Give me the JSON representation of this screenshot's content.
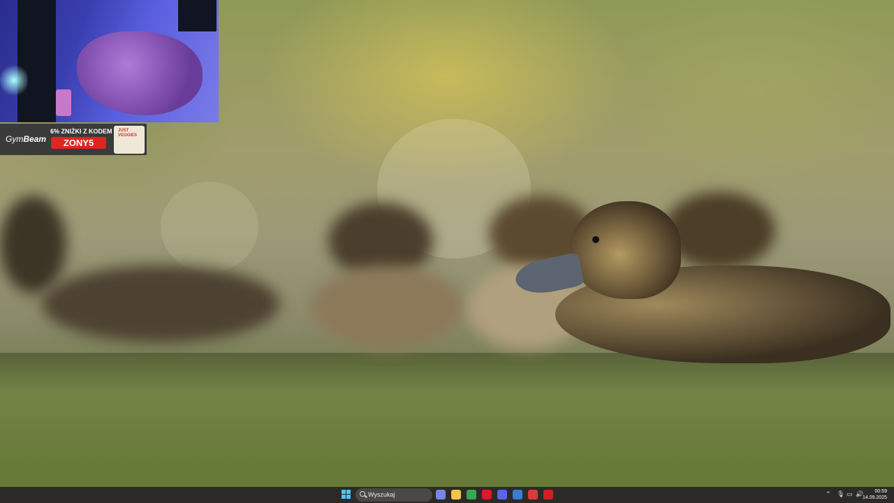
{
  "wallpaper": {
    "subject": "ducklings-on-water"
  },
  "overlay": {
    "banner": {
      "brand_prefix": "Gym",
      "brand_suffix": "Beam",
      "promo_text": "6% ZNIŻKI Z KODEM",
      "code": "ZONY5",
      "pack_text": "JUST VEGGIES"
    }
  },
  "taskbar": {
    "search_placeholder": "Wyszukaj",
    "apps": [
      {
        "name": "teams-icon",
        "color": "#7b83eb"
      },
      {
        "name": "file-explorer-icon",
        "color": "#f5c34b"
      },
      {
        "name": "chrome-icon",
        "color": "#34a853"
      },
      {
        "name": "opera-icon",
        "color": "#e0162b"
      },
      {
        "name": "discord-icon",
        "color": "#5865f2"
      },
      {
        "name": "terminal-icon",
        "color": "#3a7bd5"
      },
      {
        "name": "app-icon-7",
        "color": "#d83b3b"
      },
      {
        "name": "app-icon-8",
        "color": "#c22"
      }
    ],
    "time": "00:59",
    "date": "14.09.2025"
  }
}
